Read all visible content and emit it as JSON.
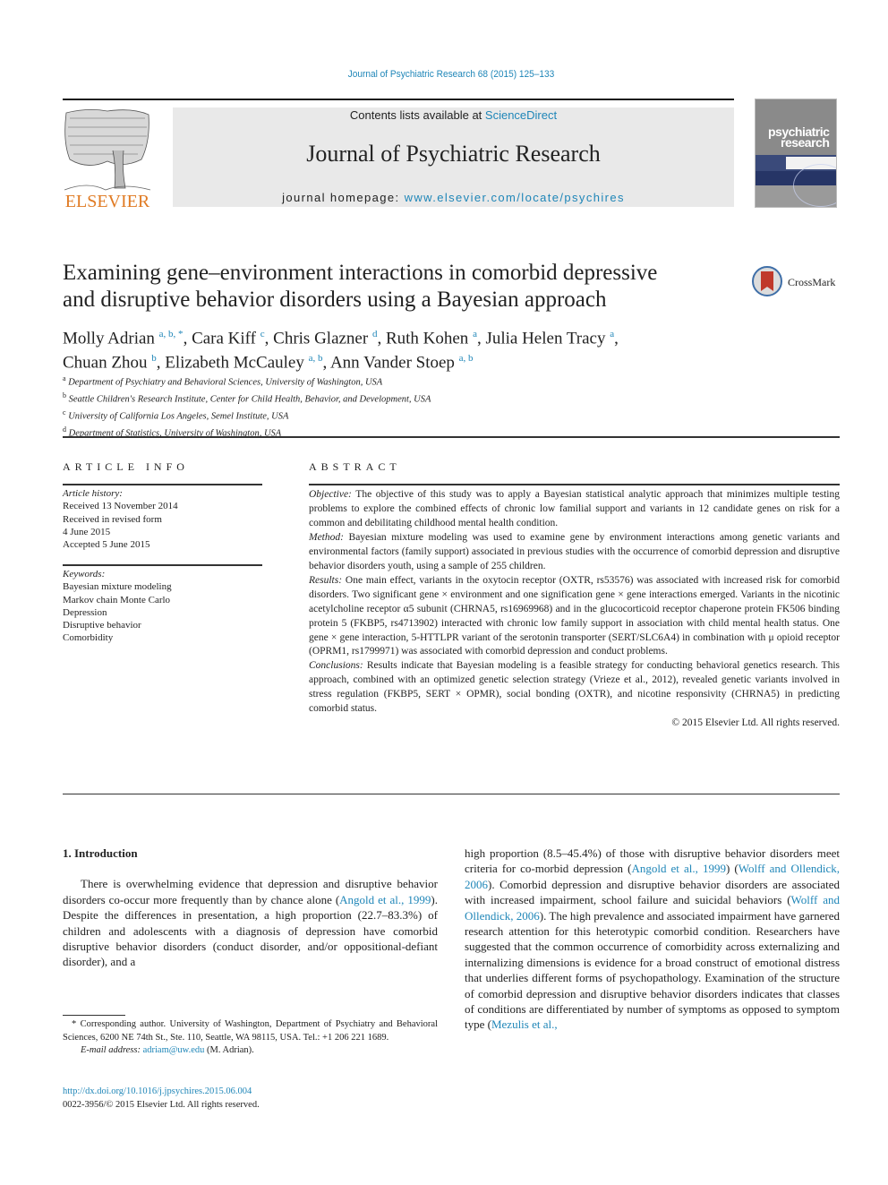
{
  "running_header": "Journal of Psychiatric Research 68 (2015) 125–133",
  "masthead": {
    "publisher_logo_text": "ELSEVIER",
    "contents_prefix": "Contents lists available at ",
    "contents_link": "ScienceDirect",
    "journal_title": "Journal of Psychiatric Research",
    "homepage_prefix": "journal homepage: ",
    "homepage_link": "www.elsevier.com/locate/psychires",
    "cover_title_line1": "psychiatric",
    "cover_title_line2": "research"
  },
  "crossmark_label": "CrossMark",
  "article": {
    "title_line1": "Examining gene–environment interactions in comorbid depressive",
    "title_line2": "and disruptive behavior disorders using a Bayesian approach",
    "authors": [
      {
        "name": "Molly Adrian",
        "sup": "a, b, *"
      },
      {
        "name": "Cara Kiff",
        "sup": "c"
      },
      {
        "name": "Chris Glazner",
        "sup": "d"
      },
      {
        "name": "Ruth Kohen",
        "sup": "a"
      },
      {
        "name": "Julia Helen Tracy",
        "sup": "a"
      },
      {
        "name": "Chuan Zhou",
        "sup": "b"
      },
      {
        "name": "Elizabeth McCauley",
        "sup": "a, b"
      },
      {
        "name": "Ann Vander Stoep",
        "sup": "a, b"
      }
    ],
    "affiliations": [
      {
        "mark": "a",
        "text": "Department of Psychiatry and Behavioral Sciences, University of Washington, USA"
      },
      {
        "mark": "b",
        "text": "Seattle Children's Research Institute, Center for Child Health, Behavior, and Development, USA"
      },
      {
        "mark": "c",
        "text": "University of California Los Angeles, Semel Institute, USA"
      },
      {
        "mark": "d",
        "text": "Department of Statistics, University of Washington, USA"
      }
    ]
  },
  "article_info": {
    "heading": "ARTICLE INFO",
    "history_label": "Article history:",
    "history": [
      "Received 13 November 2014",
      "Received in revised form",
      "4 June 2015",
      "Accepted 5 June 2015"
    ],
    "keywords_label": "Keywords:",
    "keywords": [
      "Bayesian mixture modeling",
      "Markov chain Monte Carlo",
      "Depression",
      "Disruptive behavior",
      "Comorbidity"
    ]
  },
  "abstract": {
    "heading": "ABSTRACT",
    "sections": [
      {
        "label": "Objective:",
        "text": " The objective of this study was to apply a Bayesian statistical analytic approach that minimizes multiple testing problems to explore the combined effects of chronic low familial support and variants in 12 candidate genes on risk for a common and debilitating childhood mental health condition."
      },
      {
        "label": "Method:",
        "text": " Bayesian mixture modeling was used to examine gene by environment interactions among genetic variants and environmental factors (family support) associated in previous studies with the occurrence of comorbid depression and disruptive behavior disorders youth, using a sample of 255 children."
      },
      {
        "label": "Results:",
        "text": " One main effect, variants in the oxytocin receptor (OXTR, rs53576) was associated with increased risk for comorbid disorders. Two significant gene × environment and one signification gene × gene interactions emerged. Variants in the nicotinic acetylcholine receptor α5 subunit (CHRNA5, rs16969968) and in the glucocorticoid receptor chaperone protein FK506 binding protein 5 (FKBP5, rs4713902) interacted with chronic low family support in association with child mental health status. One gene × gene interaction, 5-HTTLPR variant of the serotonin transporter (SERT/SLC6A4) in combination with μ opioid receptor (OPRM1, rs1799971) was associated with comorbid depression and conduct problems."
      },
      {
        "label": "Conclusions:",
        "text": " Results indicate that Bayesian modeling is a feasible strategy for conducting behavioral genetics research. This approach, combined with an optimized genetic selection strategy (Vrieze et al., 2012), revealed genetic variants involved in stress regulation (FKBP5, SERT × OPMR), social bonding (OXTR), and nicotine responsivity (CHRNA5) in predicting comorbid status."
      }
    ],
    "copyright": "© 2015 Elsevier Ltd. All rights reserved."
  },
  "body": {
    "section_title": "1.  Introduction",
    "left_p1_a": "There is overwhelming evidence that depression and disruptive behavior disorders co-occur more frequently than by chance alone (",
    "left_p1_link1": "Angold et al., 1999",
    "left_p1_b": "). Despite the differences in presentation, a high proportion (22.7–83.3%) of children and adolescents with a diagnosis of depression have comorbid disruptive behavior disorders (conduct disorder, and/or oppositional-defiant disorder), and a",
    "right_a": "high proportion (8.5–45.4%) of those with disruptive behavior disorders meet criteria for co-morbid depression (",
    "right_link1": "Angold et al., 1999",
    "right_b": ") (",
    "right_link2": "Wolff and Ollendick, 2006",
    "right_c": "). Comorbid depression and disruptive behavior disorders are associated with increased impairment, school failure and suicidal behaviors (",
    "right_link3": "Wolff and Ollendick, 2006",
    "right_d": "). The high prevalence and associated impairment have garnered research attention for this heterotypic comorbid condition. Researchers have suggested that the common occurrence of comorbidity across externalizing and internalizing dimensions is evidence for a broad construct of emotional distress that underlies different forms of psychopathology. Examination of the structure of comorbid depression and disruptive behavior disorders indicates that classes of conditions are differentiated by number of symptoms as opposed to symptom type (",
    "right_link4": "Mezulis et al.,"
  },
  "footnote": {
    "corresponding": "* Corresponding author. University of Washington, Department of Psychiatry and Behavioral Sciences, 6200 NE 74th St., Ste. 110, Seattle, WA 98115, USA. Tel.: +1 206 221 1689.",
    "email_label": "E-mail address: ",
    "email": "adriam@uw.edu",
    "email_suffix": " (M. Adrian).",
    "doi": "http://dx.doi.org/10.1016/j.jpsychires.2015.06.004",
    "issn": "0022-3956/© 2015 Elsevier Ltd. All rights reserved."
  }
}
